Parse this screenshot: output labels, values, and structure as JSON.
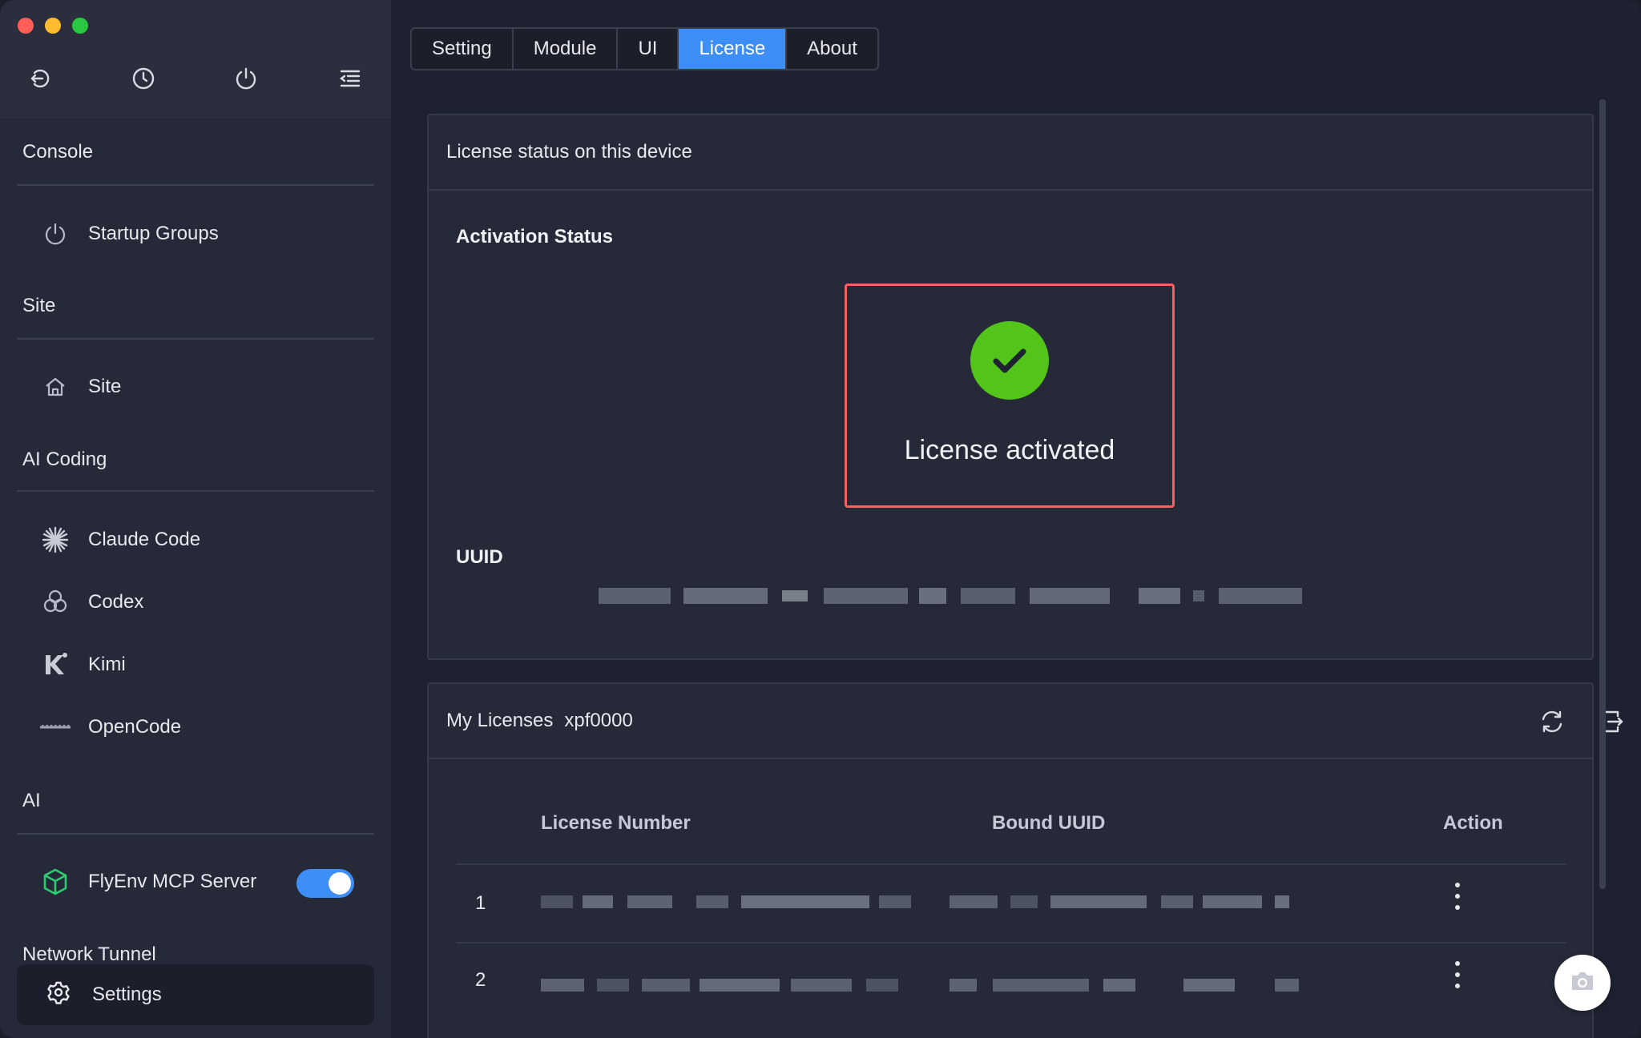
{
  "tabs": [
    {
      "label": "Setting",
      "active": false
    },
    {
      "label": "Module",
      "active": false
    },
    {
      "label": "UI",
      "active": false
    },
    {
      "label": "License",
      "active": true
    },
    {
      "label": "About",
      "active": false
    }
  ],
  "sidebar": {
    "top_icons": [
      "back-arrow-icon",
      "clock-icon",
      "power-icon",
      "menu-collapse-icon"
    ],
    "sections": {
      "console": "Console",
      "site": "Site",
      "ai_coding": "AI Coding",
      "ai": "AI",
      "network_tunnel": "Network Tunnel"
    },
    "items": {
      "startup_groups": "Startup Groups",
      "site": "Site",
      "claude_code": "Claude Code",
      "codex": "Codex",
      "kimi": "Kimi",
      "opencode": "OpenCode",
      "flyenv_mcp": "FlyEnv MCP Server",
      "settings": "Settings"
    },
    "mcp_toggle_on": true
  },
  "license_status": {
    "header": "License status on this device",
    "activation_label": "Activation Status",
    "activated_text": "License activated",
    "uuid_label": "UUID"
  },
  "my_licenses": {
    "title": "My Licenses",
    "user": "xpf0000",
    "columns": [
      "License Number",
      "Bound UUID",
      "Action"
    ],
    "rows": [
      {
        "num": "1"
      },
      {
        "num": "2"
      }
    ]
  },
  "colors": {
    "accent": "#3d8ef6",
    "success": "#52c41a",
    "highlight_border": "#f26563"
  }
}
